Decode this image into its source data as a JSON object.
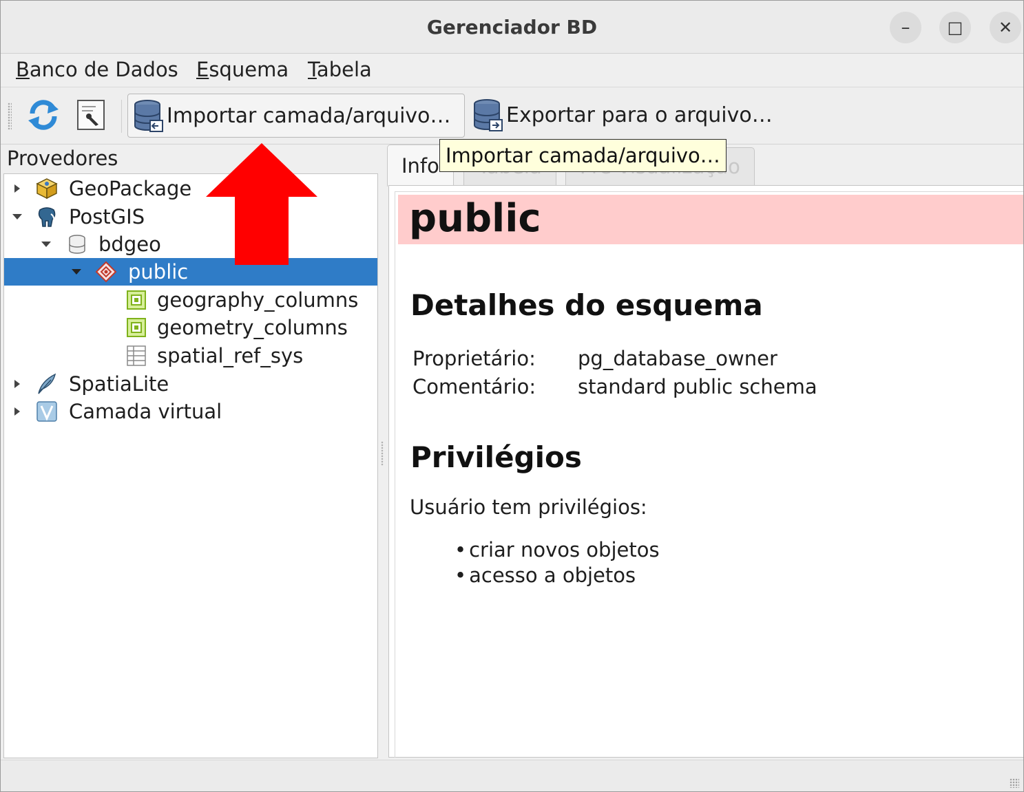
{
  "window": {
    "title": "Gerenciador BD",
    "controls": {
      "minimize": "–",
      "maximize": "□",
      "close": "✕"
    }
  },
  "menubar": {
    "items": [
      {
        "label": "Banco de Dados",
        "mnemonic": "B",
        "rest": "anco de Dados"
      },
      {
        "label": "Esquema",
        "mnemonic": "E",
        "rest": "squema"
      },
      {
        "label": "Tabela",
        "mnemonic": "T",
        "rest": "abela"
      }
    ]
  },
  "toolbar": {
    "refresh_icon": "refresh-icon",
    "sql_window_icon": "sql-window-icon",
    "import_label": "Importar camada/arquivo…",
    "export_label": "Exportar para o arquivo…"
  },
  "tooltip": {
    "text": "Importar camada/arquivo…"
  },
  "providers": {
    "heading": "Provedores",
    "tree": [
      {
        "label": "GeoPackage",
        "icon": "geopackage-icon",
        "expanded": false
      },
      {
        "label": "PostGIS",
        "icon": "postgis-elephant-icon",
        "expanded": true
      },
      {
        "label": "bdgeo",
        "icon": "database-icon",
        "expanded": true
      },
      {
        "label": "public",
        "icon": "schema-icon",
        "expanded": true,
        "selected": true
      },
      {
        "label": "geography_columns",
        "icon": "view-icon"
      },
      {
        "label": "geometry_columns",
        "icon": "view-icon"
      },
      {
        "label": "spatial_ref_sys",
        "icon": "table-icon"
      },
      {
        "label": "SpatiaLite",
        "icon": "spatialite-feather-icon",
        "expanded": false
      },
      {
        "label": "Camada virtual",
        "icon": "virtual-layer-icon",
        "expanded": false
      }
    ]
  },
  "tabs": [
    {
      "label": "Info",
      "active": true
    },
    {
      "label": "Tabela",
      "active": false
    },
    {
      "label": "Pré-visualização",
      "active": false
    }
  ],
  "info": {
    "header": "public",
    "details_heading": "Detalhes do esquema",
    "owner_label": "Proprietário:",
    "owner_value": "pg_database_owner",
    "comment_label": "Comentário:",
    "comment_value": "standard public schema",
    "privileges_heading": "Privilégios",
    "privileges_intro": "Usuário tem privilégios:",
    "privileges": [
      "criar novos objetos",
      "acesso a objetos"
    ]
  },
  "colors": {
    "selection": "#2f7cc7",
    "header_bar": "#ffcccc",
    "tooltip_bg": "#ffffdc",
    "annotation_arrow": "#ff0000"
  }
}
